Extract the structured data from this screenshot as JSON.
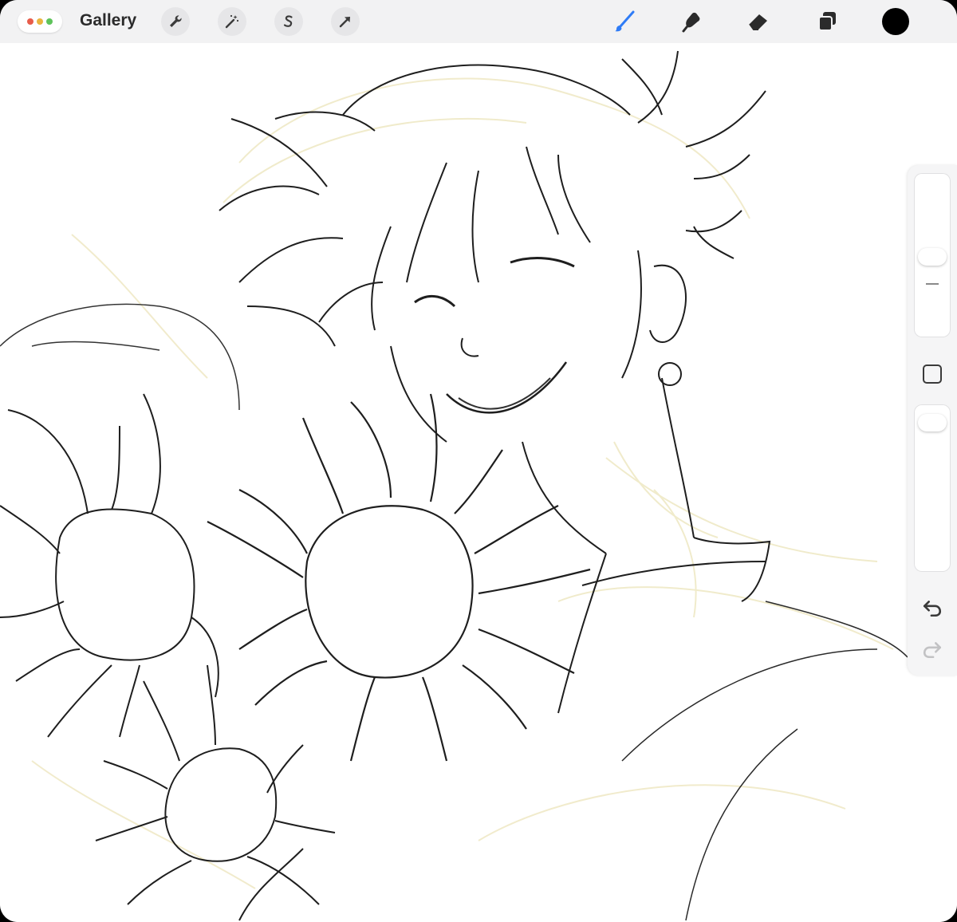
{
  "topbar": {
    "gallery_label": "Gallery",
    "left_tools": [
      "wrench-icon",
      "magic-wand-icon",
      "selection-icon",
      "transform-arrow-icon"
    ],
    "right_tools": [
      "brush-icon",
      "smudge-icon",
      "eraser-icon",
      "layers-icon"
    ],
    "active_color": "#000000",
    "active_tool_color": "#2f7cf6"
  },
  "sidebar": {
    "controls": [
      "brush-size-slider",
      "modify-button",
      "opacity-slider",
      "undo-button",
      "redo-button"
    ]
  },
  "canvas": {
    "description_icon": "sketch-artwork"
  }
}
